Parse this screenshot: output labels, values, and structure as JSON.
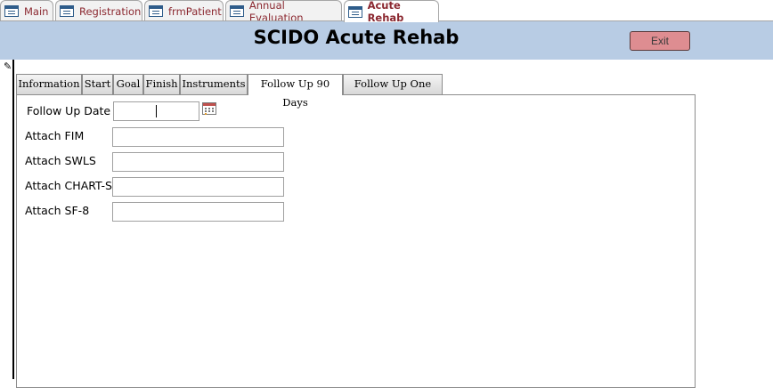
{
  "doc_tabs": [
    {
      "label": "Main"
    },
    {
      "label": "Registration"
    },
    {
      "label": "frmPatient"
    },
    {
      "label": "Annual Evaluation"
    },
    {
      "label": "Acute Rehab",
      "active": true
    }
  ],
  "header": {
    "title": "SCIDO Acute Rehab",
    "exit_label": "Exit"
  },
  "record_selector": {
    "icon": "pencil-icon",
    "glyph": "✎"
  },
  "form_tabs": [
    {
      "label": "Information"
    },
    {
      "label": "Start"
    },
    {
      "label": "Goal"
    },
    {
      "label": "Finish"
    },
    {
      "label": "Instruments"
    },
    {
      "label": "Follow Up 90 Days",
      "active": true
    },
    {
      "label": "Follow Up One Year"
    }
  ],
  "fields": {
    "follow_up_date": {
      "label": "Follow Up Date",
      "value": ""
    },
    "attach_fim": {
      "label": "Attach FIM",
      "value": ""
    },
    "attach_swls": {
      "label": "Attach SWLS",
      "value": ""
    },
    "attach_chart_s": {
      "label": "Attach CHART-S",
      "value": ""
    },
    "attach_sf8": {
      "label": "Attach SF-8",
      "value": ""
    }
  },
  "colors": {
    "header_band": "#b8cce4",
    "exit_button": "#de8d91",
    "doc_tab_text": "#8b2830"
  }
}
